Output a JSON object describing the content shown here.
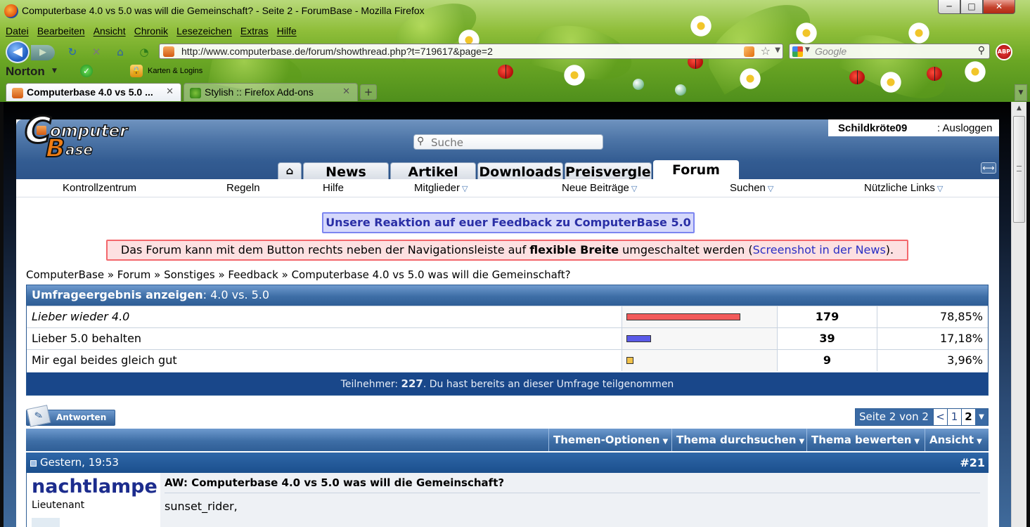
{
  "window": {
    "title": "Computerbase 4.0 vs 5.0 was will die Gemeinschaft? - Seite 2 - ForumBase - Mozilla Firefox",
    "minimize_glyph": "─",
    "maximize_glyph": "□",
    "close_glyph": "✕"
  },
  "menubar": {
    "items": [
      "Datei",
      "Bearbeiten",
      "Ansicht",
      "Chronik",
      "Lesezeichen",
      "Extras",
      "Hilfe"
    ]
  },
  "navbar": {
    "url": "http://www.computerbase.de/forum/showthread.php?t=719617&page=2",
    "search_placeholder": "Google",
    "abp_label": "ABP"
  },
  "norton": {
    "label": "Norton",
    "karten_label": "Karten & Logins"
  },
  "tabs": [
    {
      "label": "Computerbase 4.0 vs 5.0 ...",
      "active": true
    },
    {
      "label": "Stylish :: Firefox Add-ons",
      "active": false
    }
  ],
  "site": {
    "logo": {
      "c": "C",
      "omputer": "omputer",
      "b": "B",
      "ase": "ase"
    },
    "search_placeholder": "Suche",
    "user": {
      "name": "Schildkröte09",
      "logout": "Ausloggen"
    },
    "main_tabs": [
      "News",
      "Artikel",
      "Downloads",
      "Preisvergleich",
      "Forum"
    ],
    "active_main_tab": "Forum",
    "subnav": [
      {
        "label": "Kontrollzentrum",
        "dropdown": false
      },
      {
        "label": "Regeln",
        "dropdown": false
      },
      {
        "label": "Hilfe",
        "dropdown": false
      },
      {
        "label": "Mitglieder",
        "dropdown": true
      },
      {
        "label": "Neue Beiträge",
        "dropdown": true
      },
      {
        "label": "Suchen",
        "dropdown": true
      },
      {
        "label": "Nützliche Links",
        "dropdown": true
      }
    ]
  },
  "feedback_button": "Unsere Reaktion auf euer Feedback zu ComputerBase 5.0",
  "notice": {
    "part1": "Das Forum kann mit dem Button rechts neben der Navigationsleiste auf ",
    "bold": "flexible Breite",
    "part2": " umgeschaltet werden (",
    "link": "Screenshot in der News",
    "part3": ")."
  },
  "breadcrumb": "ComputerBase » Forum » Sonstiges » Feedback » Computerbase 4.0 vs 5.0 was will die Gemeinschaft?",
  "poll": {
    "header_bold": "Umfrageergebnis anzeigen",
    "header_rest": ": 4.0 vs. 5.0",
    "options": [
      {
        "label": "Lieber wieder 4.0",
        "votes": "179",
        "percent": "78,85%",
        "fraction": 0.7885,
        "color": "#f25a5a",
        "italic": true
      },
      {
        "label": "Lieber 5.0 behalten",
        "votes": "39",
        "percent": "17,18%",
        "fraction": 0.1718,
        "color": "#5a5ae8",
        "italic": false
      },
      {
        "label": "Mir egal beides gleich gut",
        "votes": "9",
        "percent": "3,96%",
        "fraction": 0.0396,
        "color": "#f2c24a",
        "italic": false
      }
    ],
    "footer_pre": "Teilnehmer: ",
    "footer_count": "227",
    "footer_post": ". Du hast bereits an dieser Umfrage teilgenommen"
  },
  "reply_button": "Antworten",
  "pager": {
    "label": "Seite 2 von 2",
    "prev": "<",
    "page1": "1",
    "page2": "2"
  },
  "thread_tools": [
    "Themen-Optionen",
    "Thema durchsuchen",
    "Thema bewerten",
    "Ansicht"
  ],
  "post": {
    "date": "Gestern, 19:53",
    "number": "#21",
    "username": "nachtlampe",
    "rank": "Lieutenant",
    "title": "AW: Computerbase 4.0 vs 5.0 was will die Gemeinschaft?",
    "text": "sunset_rider,"
  },
  "colors": {
    "header_blue": "#335c92",
    "poll_footer": "#19478a",
    "notice_border": "#f3676c",
    "feedback_border": "#7c85f0"
  }
}
